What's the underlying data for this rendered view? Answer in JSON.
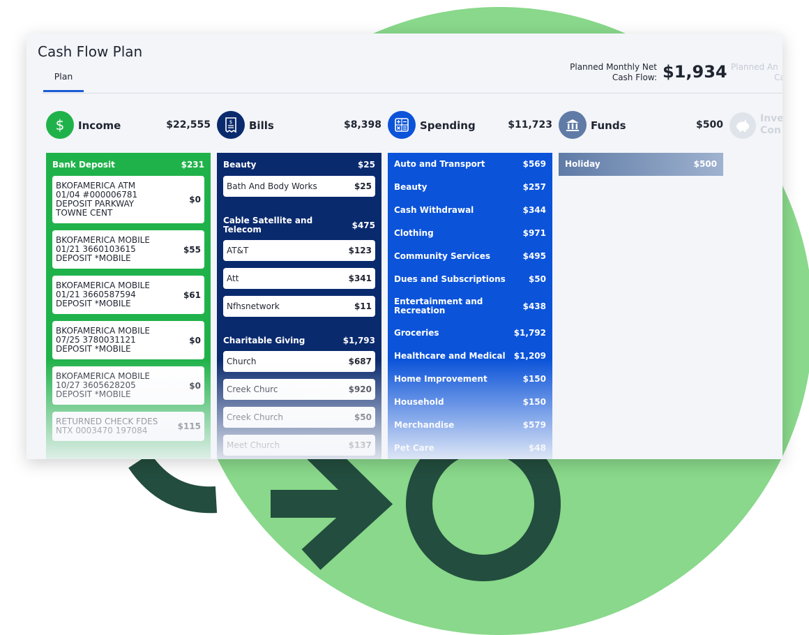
{
  "title": "Cash Flow Plan",
  "tabs": [
    {
      "label": "Plan"
    }
  ],
  "net": {
    "label_line1": "Planned Monthly Net",
    "label_line2": "Cash Flow:",
    "value": "$1,934"
  },
  "ghost_net": {
    "line1": "Planned An",
    "line2": "Ca"
  },
  "colors": {
    "income": "#20b24a",
    "bills": "#0a2a6e",
    "spending": "#0b53d9",
    "funds": "#5f7ba6",
    "accent": "#1b5bd3",
    "background_circle": "#89d88b",
    "decor": "#234d3e"
  },
  "columns": {
    "income": {
      "icon": "dollar-icon",
      "name": "Income",
      "total": "$22,555"
    },
    "bills": {
      "icon": "receipt-icon",
      "name": "Bills",
      "total": "$8,398"
    },
    "spending": {
      "icon": "calculator-icon",
      "name": "Spending",
      "total": "$11,723"
    },
    "funds": {
      "icon": "bank-icon",
      "name": "Funds",
      "total": "$500"
    },
    "investments": {
      "icon": "piggy-bank-icon",
      "name_line1": "Inve",
      "name_line2": "Con"
    }
  },
  "income": {
    "group": {
      "name": "Bank Deposit",
      "amount": "$231"
    },
    "items": [
      {
        "label": "BKOFAMERICA ATM\n01/04 #000006781\nDEPOSIT PARKWAY\nTOWNE CENT",
        "amount": "$0"
      },
      {
        "label": "BKOFAMERICA MOBILE\n01/21 3660103615\nDEPOSIT *MOBILE",
        "amount": "$55"
      },
      {
        "label": "BKOFAMERICA MOBILE\n01/21 3660587594\nDEPOSIT *MOBILE",
        "amount": "$61"
      },
      {
        "label": "BKOFAMERICA MOBILE\n07/25 3780031121\nDEPOSIT *MOBILE",
        "amount": "$0"
      },
      {
        "label": "BKOFAMERICA MOBILE\n10/27 3605628205\nDEPOSIT *MOBILE",
        "amount": "$0"
      },
      {
        "label": "RETURNED CHECK FDES\nNTX 0003470 197084",
        "amount": "$115"
      }
    ]
  },
  "bills": {
    "groups": [
      {
        "name": "Beauty",
        "amount": "$25",
        "items": [
          {
            "label": "Bath And Body Works",
            "amount": "$25"
          }
        ]
      },
      {
        "name": "Cable Satellite and\nTelecom",
        "amount": "$475",
        "items": [
          {
            "label": "AT&T",
            "amount": "$123"
          },
          {
            "label": "Att",
            "amount": "$341"
          },
          {
            "label": "Nfhsnetwork",
            "amount": "$11"
          }
        ]
      },
      {
        "name": "Charitable Giving",
        "amount": "$1,793",
        "items": [
          {
            "label": "Church",
            "amount": "$687"
          },
          {
            "label": "Creek Churc",
            "amount": "$920"
          },
          {
            "label": "Creek Church",
            "amount": "$50"
          },
          {
            "label": "Meet Church",
            "amount": "$137"
          }
        ]
      }
    ]
  },
  "spending": {
    "rows": [
      {
        "label": "Auto and Transport",
        "amount": "$569"
      },
      {
        "label": "Beauty",
        "amount": "$257"
      },
      {
        "label": "Cash Withdrawal",
        "amount": "$344"
      },
      {
        "label": "Clothing",
        "amount": "$971"
      },
      {
        "label": "Community Services",
        "amount": "$495"
      },
      {
        "label": "Dues and Subscriptions",
        "amount": "$50"
      },
      {
        "label": "Entertainment and\nRecreation",
        "amount": "$438"
      },
      {
        "label": "Groceries",
        "amount": "$1,792"
      },
      {
        "label": "Healthcare and Medical",
        "amount": "$1,209"
      },
      {
        "label": "Home Improvement",
        "amount": "$150"
      },
      {
        "label": "Household",
        "amount": "$150"
      },
      {
        "label": "Merchandise",
        "amount": "$579"
      },
      {
        "label": "Pet Care",
        "amount": "$48"
      }
    ]
  },
  "funds": {
    "rows": [
      {
        "label": "Holiday",
        "amount": "$500"
      }
    ]
  }
}
